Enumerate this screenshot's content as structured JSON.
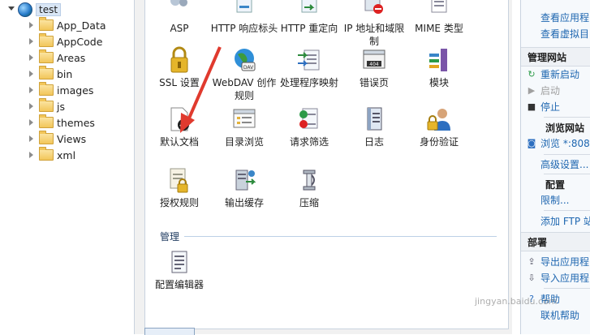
{
  "tree": {
    "root": "test",
    "items": [
      "App_Data",
      "AppCode",
      "Areas",
      "bin",
      "images",
      "js",
      "themes",
      "Views",
      "xml"
    ]
  },
  "features": [
    {
      "label": "ASP",
      "icon": "asp-icon"
    },
    {
      "label": "HTTP 响应标头",
      "icon": "http-response-headers-icon"
    },
    {
      "label": "HTTP 重定向",
      "icon": "http-redirect-icon"
    },
    {
      "label": "IP 地址和域限制",
      "icon": "ip-restrictions-icon"
    },
    {
      "label": "MIME 类型",
      "icon": "mime-types-icon"
    },
    {
      "label": "SSL 设置",
      "icon": "ssl-lock-icon"
    },
    {
      "label": "WebDAV 创作规则",
      "icon": "webdav-globe-icon"
    },
    {
      "label": "处理程序映射",
      "icon": "handler-mappings-icon"
    },
    {
      "label": "错误页",
      "icon": "error-pages-404-icon"
    },
    {
      "label": "模块",
      "icon": "modules-icon"
    },
    {
      "label": "默认文档",
      "icon": "default-document-icon"
    },
    {
      "label": "目录浏览",
      "icon": "directory-browsing-icon"
    },
    {
      "label": "请求筛选",
      "icon": "request-filtering-icon"
    },
    {
      "label": "日志",
      "icon": "logging-icon"
    },
    {
      "label": "身份验证",
      "icon": "authentication-icon"
    },
    {
      "label": "授权规则",
      "icon": "authorization-rules-icon"
    },
    {
      "label": "输出缓存",
      "icon": "output-caching-icon"
    },
    {
      "label": "压缩",
      "icon": "compression-icon"
    }
  ],
  "manage_group": {
    "label": "管理",
    "items": [
      {
        "label": "配置编辑器",
        "icon": "configuration-editor-icon"
      }
    ]
  },
  "actions": {
    "top_links": [
      "查看应用程",
      "查看虚拟目"
    ],
    "manage_site": {
      "title": "管理网站",
      "restart": "重新启动",
      "start": "启动",
      "stop": "停止"
    },
    "browse_site": {
      "title": "浏览网站",
      "browse": "浏览 *:808"
    },
    "advanced": "高级设置...",
    "config": {
      "title": "配置",
      "limits": "限制...",
      "add_ftp": "添加 FTP 站"
    },
    "deploy": {
      "title": "部署",
      "export": "导出应用程",
      "import": "导入应用程"
    },
    "help": "帮助",
    "online_help": "联机帮助"
  },
  "watermark": "jingyan.baidu.com",
  "colors": {
    "link": "#1e66b0",
    "selection": "#d9e6f5",
    "arrow": "#e03a2e"
  }
}
